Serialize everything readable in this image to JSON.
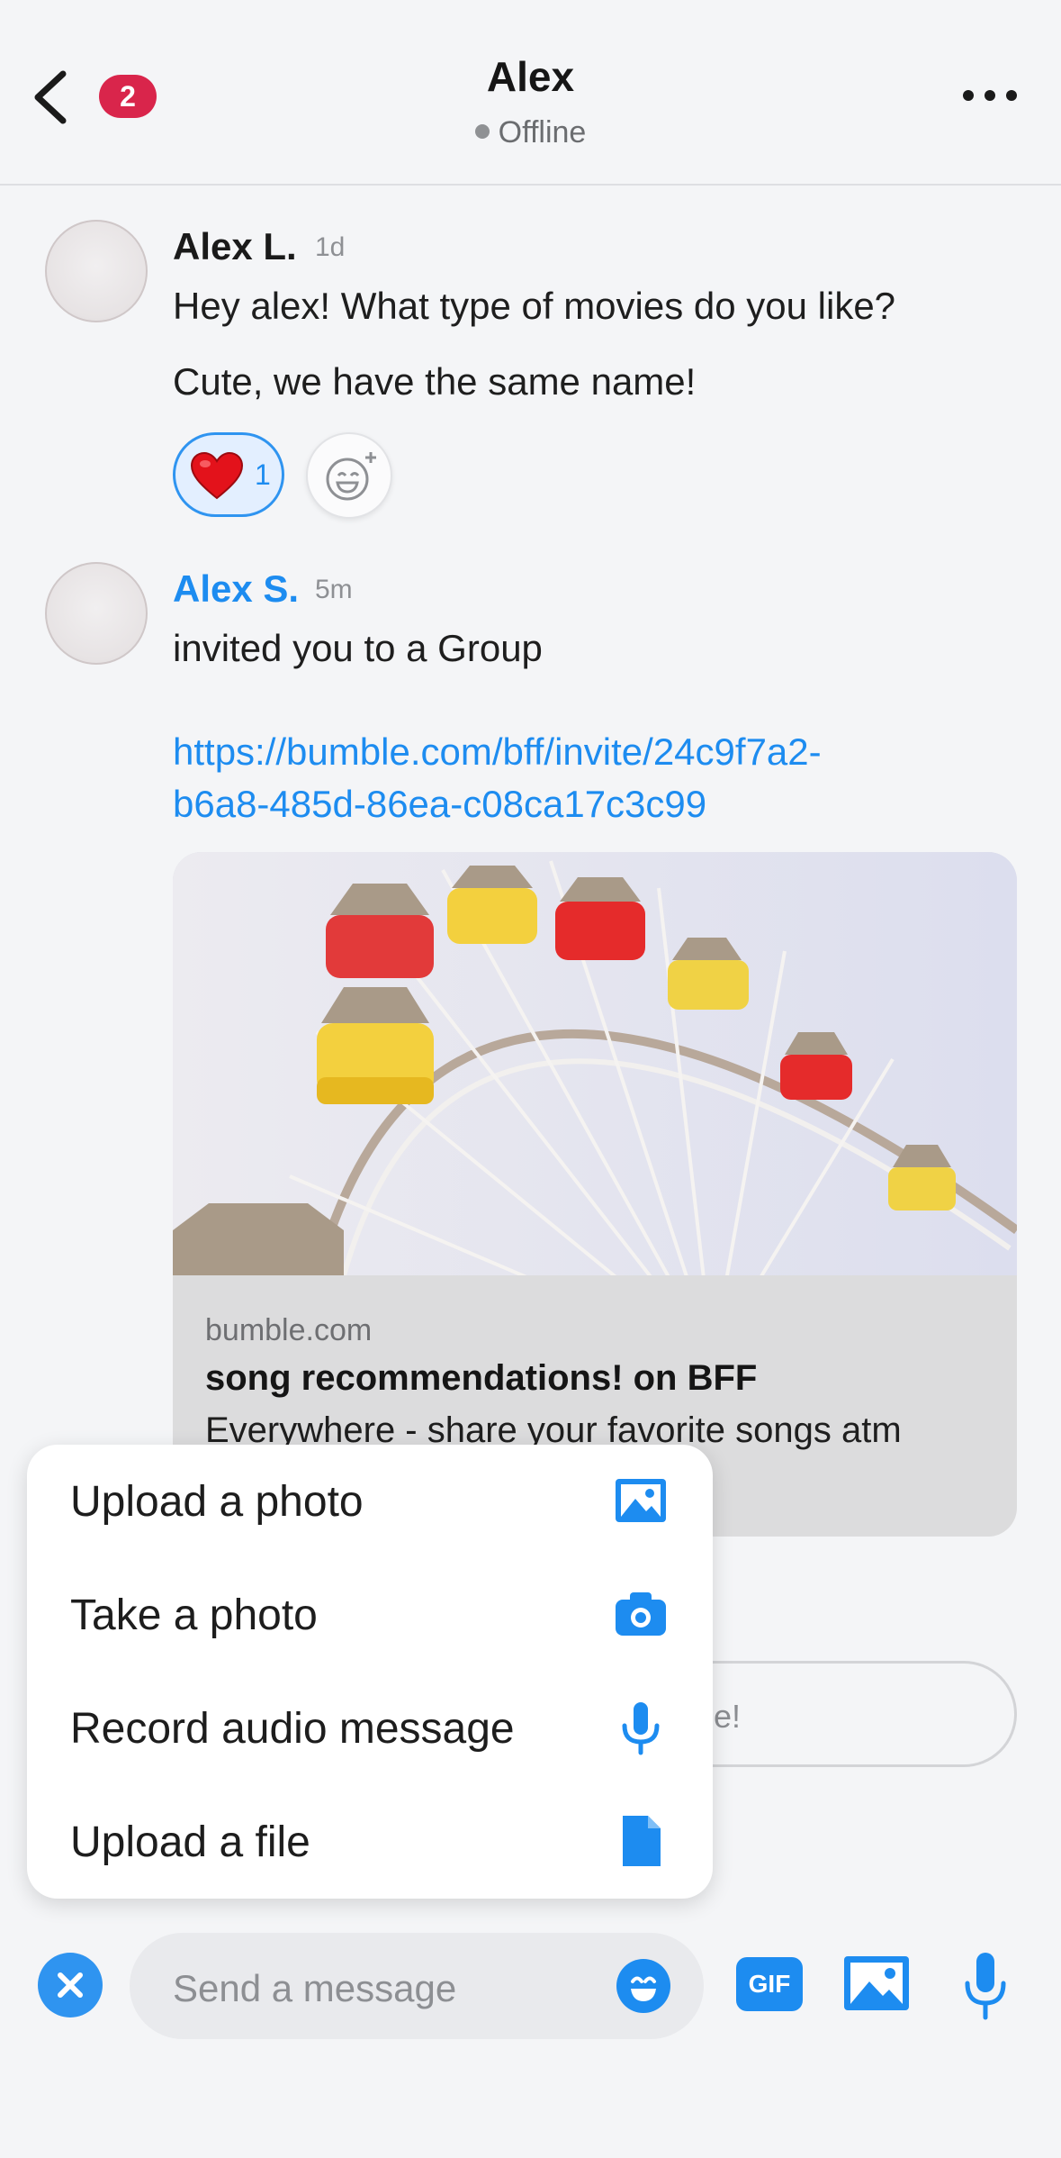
{
  "header": {
    "title": "Alex",
    "status": "Offline",
    "unread_badge": "2"
  },
  "messages": [
    {
      "sender": "Alex L.",
      "time": "1d",
      "lines": [
        "Hey alex! What type of movies do you like?",
        "Cute, we have the same name!"
      ],
      "reaction": {
        "emoji": "heart",
        "count": "1"
      }
    },
    {
      "sender": "Alex S.",
      "time": "5m",
      "text": "invited you to a Group",
      "link_line1": "https://bumble.com/bff/invite/24c9f7a2-",
      "link_line2": "b6a8-485d-86ea-c08ca17c3c99",
      "preview": {
        "domain": "bumble.com",
        "title": "song recommendations! on BFF",
        "description": "Everywhere - share your favorite songs atm"
      }
    }
  ],
  "hidden_input_fragment": "e!",
  "attachment_menu": [
    {
      "label": "Upload a photo",
      "icon": "image-icon"
    },
    {
      "label": "Take a photo",
      "icon": "camera-icon"
    },
    {
      "label": "Record audio message",
      "icon": "microphone-icon"
    },
    {
      "label": "Upload a file",
      "icon": "file-icon"
    }
  ],
  "composer": {
    "placeholder": "Send a message",
    "gif_label": "GIF"
  },
  "colors": {
    "accent": "#1d8cf0",
    "badge": "#d9254b",
    "background": "#f4f5f7"
  }
}
